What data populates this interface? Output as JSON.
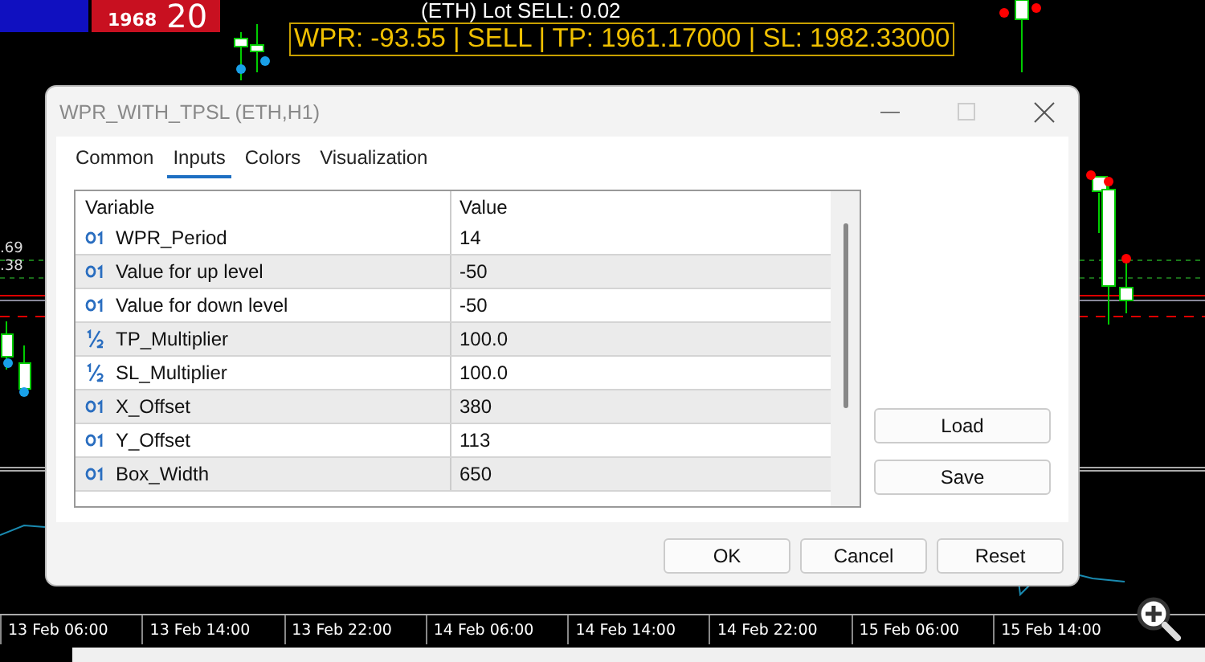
{
  "chart": {
    "badge": {
      "price": "1968",
      "big": "20"
    },
    "lot_text": "(ETH) Lot SELL: 0.02",
    "info_box": "WPR: -93.55 | SELL | TP: 1961.17000 | SL: 1982.33000",
    "price_labels": [
      ".69",
      ".38"
    ],
    "time_axis": [
      "13 Feb 06:00",
      "13 Feb 14:00",
      "13 Feb 22:00",
      "14 Feb 06:00",
      "14 Feb 14:00",
      "14 Feb 22:00",
      "15 Feb 06:00",
      "15 Feb 14:00"
    ]
  },
  "dialog": {
    "title": "WPR_WITH_TPSL (ETH,H1)",
    "tabs": [
      {
        "label": "Common",
        "selected": false
      },
      {
        "label": "Inputs",
        "selected": true
      },
      {
        "label": "Colors",
        "selected": false
      },
      {
        "label": "Visualization",
        "selected": false
      }
    ],
    "columns": [
      "Variable",
      "Value"
    ],
    "rows": [
      {
        "kind": "int",
        "variable": "WPR_Period",
        "value": "14"
      },
      {
        "kind": "int",
        "variable": "Value for up level",
        "value": "-50"
      },
      {
        "kind": "int",
        "variable": "Value for down level",
        "value": "-50"
      },
      {
        "kind": "double",
        "variable": "TP_Multiplier",
        "value": "100.0"
      },
      {
        "kind": "double",
        "variable": "SL_Multiplier",
        "value": "100.0"
      },
      {
        "kind": "int",
        "variable": "X_Offset",
        "value": "380"
      },
      {
        "kind": "int",
        "variable": "Y_Offset",
        "value": "113"
      },
      {
        "kind": "int",
        "variable": "Box_Width",
        "value": "650"
      }
    ],
    "side_buttons": [
      "Load",
      "Save"
    ],
    "buttons": [
      "OK",
      "Cancel",
      "Reset"
    ]
  }
}
